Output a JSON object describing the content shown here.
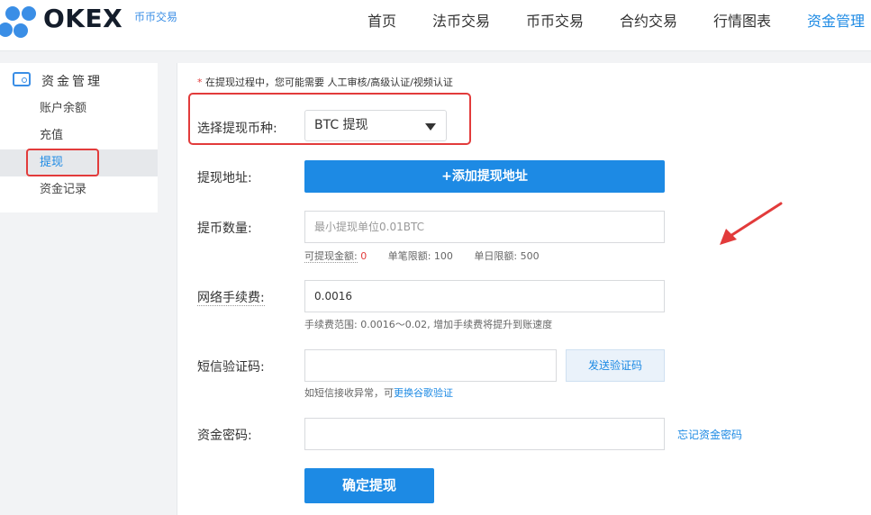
{
  "header": {
    "brand": "OKEX",
    "brand_sub": "币币交易",
    "nav": [
      "首页",
      "法币交易",
      "币币交易",
      "合约交易",
      "行情图表",
      "资金管理"
    ],
    "active_nav": "资金管理"
  },
  "sidebar": {
    "title": "资金管理",
    "items": [
      "账户余额",
      "充值",
      "提现",
      "资金记录"
    ],
    "active_item": "提现"
  },
  "form": {
    "notice_star": "*",
    "notice": "在提现过程中，您可能需要 人工审核/高级认证/视频认证",
    "currency_label": "选择提现币种:",
    "currency_value": "BTC 提现",
    "address_label": "提现地址:",
    "add_address_button": "+添加提现地址",
    "amount_label": "提币数量:",
    "amount_placeholder": "最小提现单位0.01BTC",
    "available_label": "可提现金额:",
    "available_value": "0",
    "single_limit": "单笔限额: 100",
    "daily_limit": "单日限额: 500",
    "fee_label": "网络手续费:",
    "fee_value": "0.0016",
    "fee_hint": "手续费范围: 0.0016～0.02, 增加手续费将提升到账速度",
    "sms_label": "短信验证码:",
    "sms_value": "",
    "send_code_button": "发送验证码",
    "sms_hint_prefix": "如短信接收异常，可",
    "sms_hint_link": "更换谷歌验证",
    "password_label": "资金密码:",
    "password_value": "",
    "forgot_password": "忘记资金密码",
    "confirm_button": "确定提现"
  },
  "colors": {
    "accent": "#1d8ae4",
    "annotation": "#e23b3b"
  }
}
